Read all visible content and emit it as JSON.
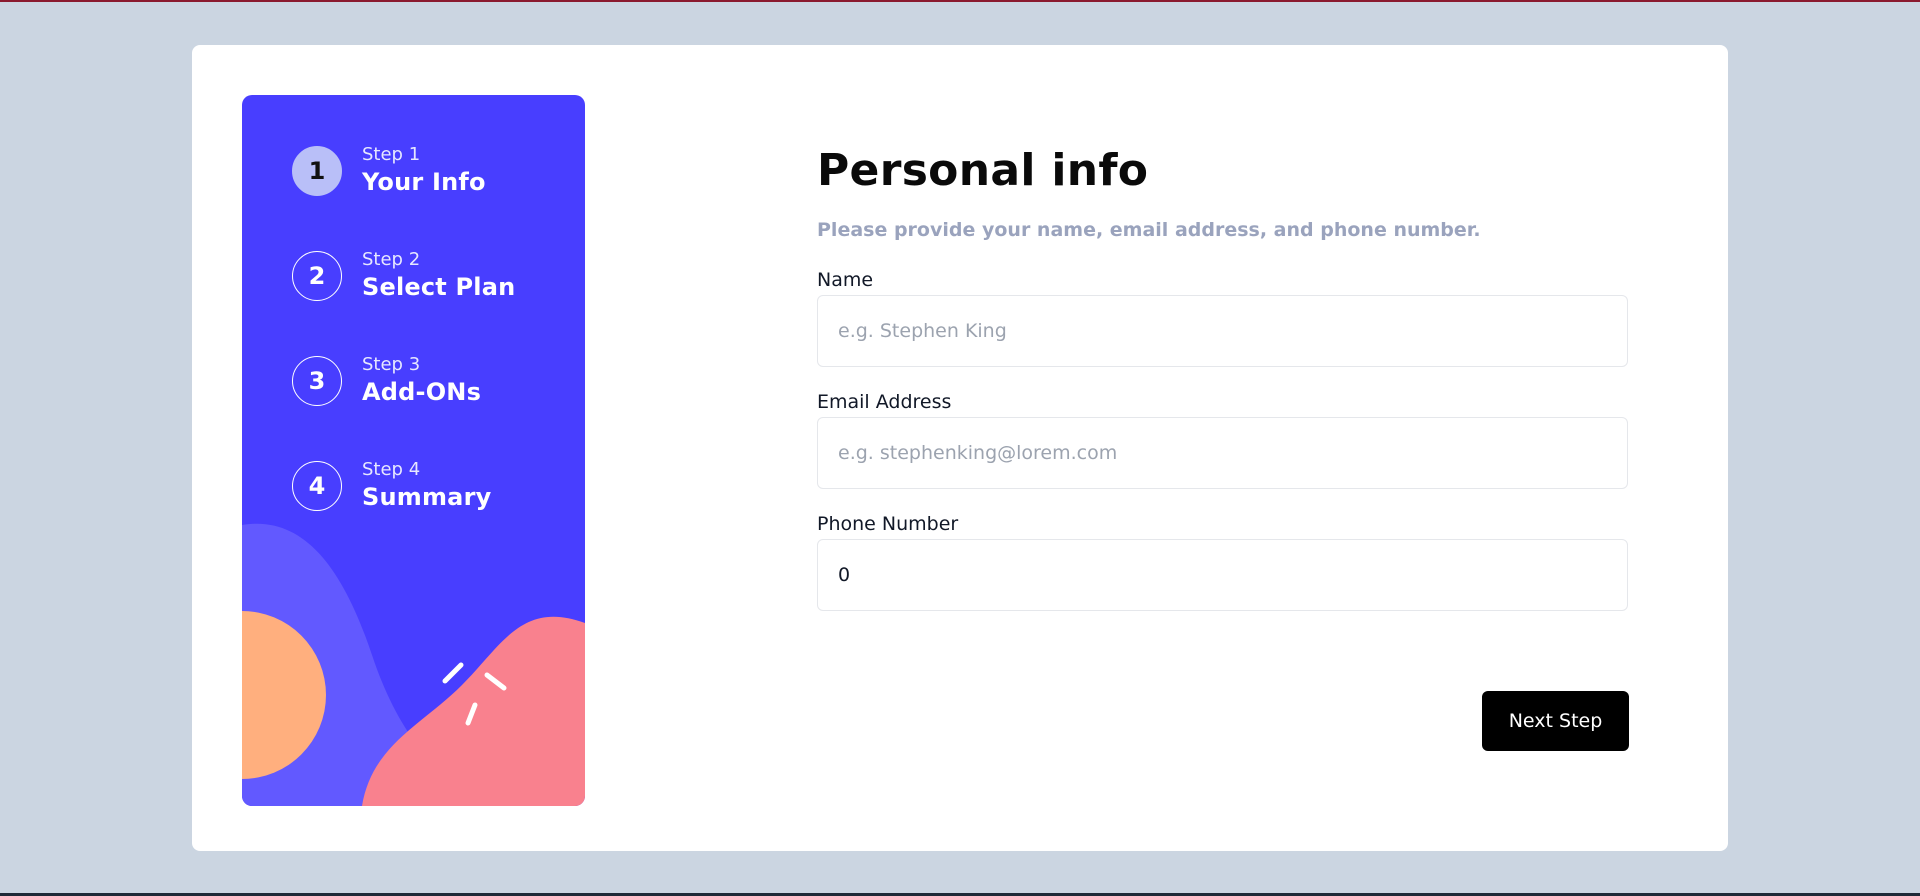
{
  "sidebar": {
    "steps": [
      {
        "number": "1",
        "step_label": "Step 1",
        "title": "Your Info",
        "active": true
      },
      {
        "number": "2",
        "step_label": "Step 2",
        "title": "Select Plan",
        "active": false
      },
      {
        "number": "3",
        "step_label": "Step 3",
        "title": "Add-ONs",
        "active": false
      },
      {
        "number": "4",
        "step_label": "Step 4",
        "title": "Summary",
        "active": false
      }
    ]
  },
  "form": {
    "title": "Personal info",
    "subtitle": "Please provide your name, email address, and phone number.",
    "fields": {
      "name": {
        "label": "Name",
        "placeholder": "e.g. Stephen King",
        "value": ""
      },
      "email": {
        "label": "Email Address",
        "placeholder": "e.g. stephenking@lorem.com",
        "value": ""
      },
      "phone": {
        "label": "Phone Number",
        "placeholder": "",
        "value": "0"
      }
    },
    "next_label": "Next Step"
  },
  "colors": {
    "sidebar_bg": "#483eff",
    "accent_light": "#b9bff8",
    "button_bg": "#000000",
    "page_bg": "#cbd5e1"
  }
}
